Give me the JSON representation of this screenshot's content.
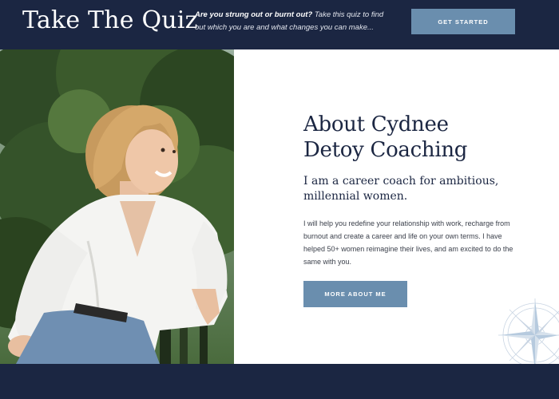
{
  "quiz_bar": {
    "title": "Take The Quiz",
    "text_bold": "Are you strung out or burnt out?",
    "text_rest": " Take this quiz to find out which you are and what changes you can make...",
    "button_label": "GET STARTED"
  },
  "about": {
    "heading_line1": "About Cydnee",
    "heading_line2": "Detoy Coaching",
    "subheading": "I am a career coach for ambitious, millennial women.",
    "body": "I will help you redefine your relationship with work, recharge from burnout and create a career and life on your own terms. I have helped 50+ women reimagine their lives, and am excited to do the same with you.",
    "button_label": "MORE ABOUT ME"
  },
  "icons": [
    "compass-rose-icon"
  ],
  "colors": {
    "navy": "#1b2642",
    "button_blue": "#6a8eae",
    "text_dark": "#3a3f4a"
  }
}
